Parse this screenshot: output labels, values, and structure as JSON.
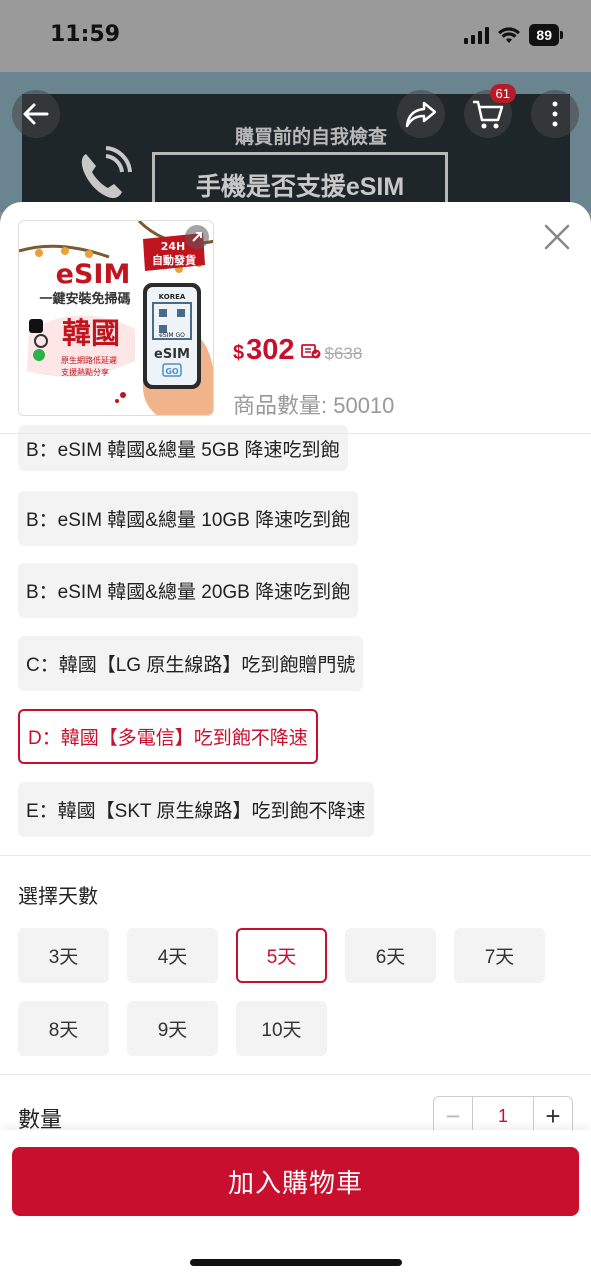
{
  "status": {
    "time": "11:59",
    "battery": "89"
  },
  "background": {
    "banner_subtitle": "購買前的自我檢查",
    "banner_title": "手機是否支援eSIM",
    "cart_count": "61"
  },
  "product": {
    "thumbnail": {
      "badge_line1": "24H",
      "badge_line2": "自動發貨",
      "brand": "eSIM",
      "tagline": "一鍵安裝免掃碼",
      "country": "韓國",
      "bullet1": "原生網路低延遲",
      "bullet2": "支援熱點分享",
      "card_label": "KOREA",
      "card_brand": "eSIM",
      "card_go": "GO",
      "qr_label": "eSIM GO"
    },
    "currency": "$",
    "price": "302",
    "original_price": "$638",
    "stock": "商品數量: 50010"
  },
  "plan_options": [
    {
      "label": "B：eSIM 韓國&總量 5GB 降速吃到飽",
      "selected": false
    },
    {
      "label": "B：eSIM 韓國&總量 10GB 降速吃到飽",
      "selected": false
    },
    {
      "label": "B：eSIM 韓國&總量 20GB 降速吃到飽",
      "selected": false
    },
    {
      "label": "C：韓國【LG 原生線路】吃到飽贈門號",
      "selected": false
    },
    {
      "label": "D：韓國【多電信】吃到飽不降速",
      "selected": true
    },
    {
      "label": "E：韓國【SKT 原生線路】吃到飽不降速",
      "selected": false
    }
  ],
  "days": {
    "label": "選擇天數",
    "options": [
      "3天",
      "4天",
      "5天",
      "6天",
      "7天",
      "8天",
      "9天",
      "10天"
    ],
    "selected": "5天"
  },
  "quantity": {
    "label": "數量",
    "value": "1",
    "minus": "−",
    "plus": "+"
  },
  "add_to_cart_label": "加入購物車",
  "colors": {
    "accent": "#c8102e"
  }
}
